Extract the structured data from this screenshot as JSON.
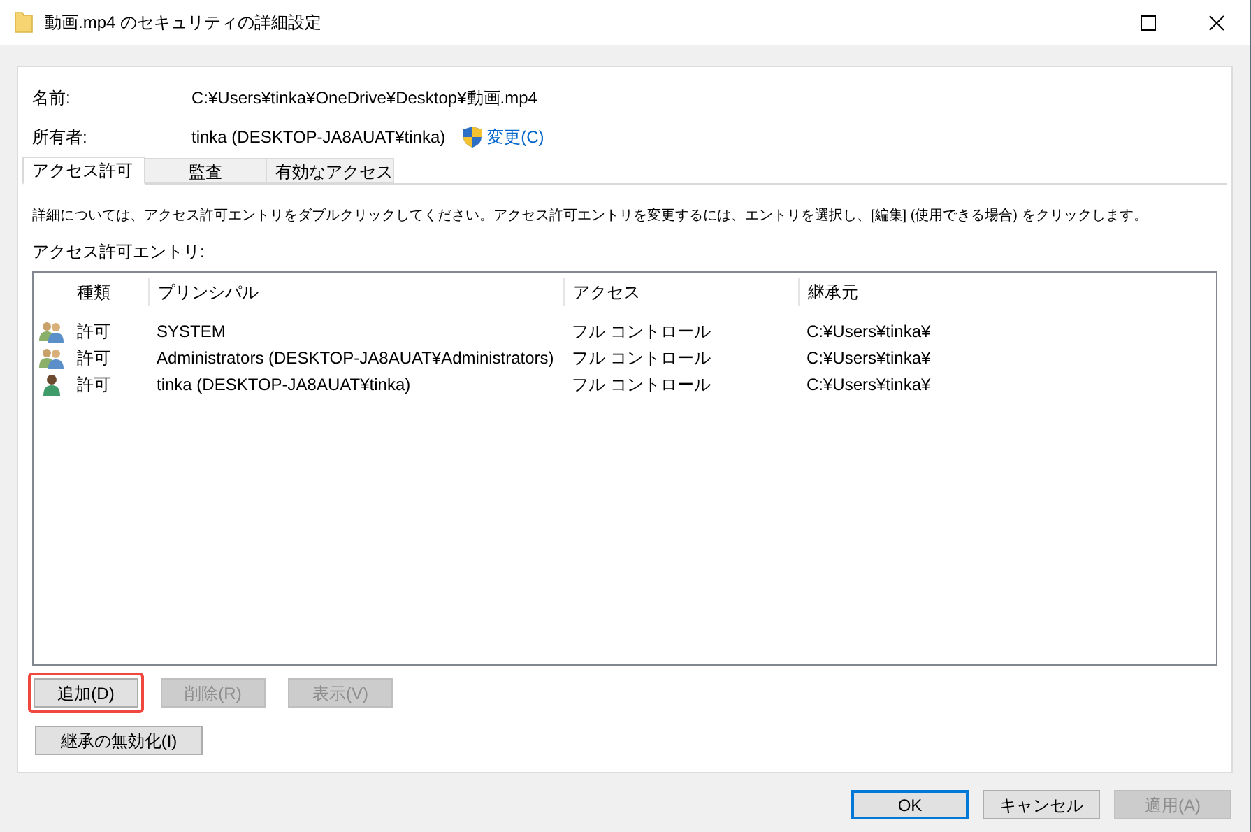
{
  "window": {
    "title": "動画.mp4 のセキュリティの詳細設定"
  },
  "fields": [
    {
      "label": "名前:",
      "value": "C:¥Users¥tinka¥OneDrive¥Desktop¥動画.mp4"
    },
    {
      "label": "所有者:",
      "value": "tinka (DESKTOP-JA8AUAT¥tinka)",
      "link": "変更(C)"
    }
  ],
  "tabs": [
    {
      "label": "アクセス許可",
      "selected": true
    },
    {
      "label": "監査",
      "selected": false
    },
    {
      "label": "有効なアクセス",
      "selected": false
    }
  ],
  "description": "詳細については、アクセス許可エントリをダブルクリックしてください。アクセス許可エントリを変更するには、エントリを選択し、[編集] (使用できる場合) をクリックします。",
  "list_label": "アクセス許可エントリ:",
  "table": {
    "columns": [
      "種類",
      "プリンシパル",
      "アクセス",
      "継承元"
    ],
    "rows": [
      {
        "kind": "group",
        "type": "許可",
        "principal": "SYSTEM",
        "access": "フル コントロール",
        "inherited_from": "C:¥Users¥tinka¥"
      },
      {
        "kind": "group",
        "type": "許可",
        "principal": "Administrators (DESKTOP-JA8AUAT¥Administrators)",
        "access": "フル コントロール",
        "inherited_from": "C:¥Users¥tinka¥"
      },
      {
        "kind": "user",
        "type": "許可",
        "principal": "tinka (DESKTOP-JA8AUAT¥tinka)",
        "access": "フル コントロール",
        "inherited_from": "C:¥Users¥tinka¥"
      }
    ]
  },
  "entry_buttons": [
    {
      "label": "追加(D)",
      "disabled": false,
      "highlighted": true
    },
    {
      "label": "削除(R)",
      "disabled": true,
      "highlighted": false
    },
    {
      "label": "表示(V)",
      "disabled": true,
      "highlighted": false
    }
  ],
  "inheritance_button": {
    "label": "継承の無効化(I)",
    "disabled": false
  },
  "dialog_buttons": [
    {
      "label": "OK",
      "disabled": false,
      "focused": true
    },
    {
      "label": "キャンセル",
      "disabled": false,
      "focused": false
    },
    {
      "label": "適用(A)",
      "disabled": true,
      "focused": false
    }
  ]
}
